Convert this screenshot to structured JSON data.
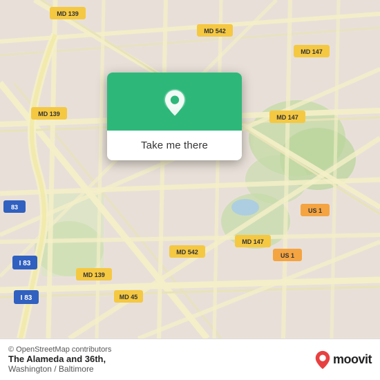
{
  "map": {
    "attribution": "© OpenStreetMap contributors",
    "background_color": "#e8e0d8"
  },
  "popup": {
    "button_label": "Take me there"
  },
  "bottom_bar": {
    "location_title": "The Alameda and 36th,",
    "location_subtitle": "Washington / Baltimore",
    "moovit_text": "moovit"
  }
}
